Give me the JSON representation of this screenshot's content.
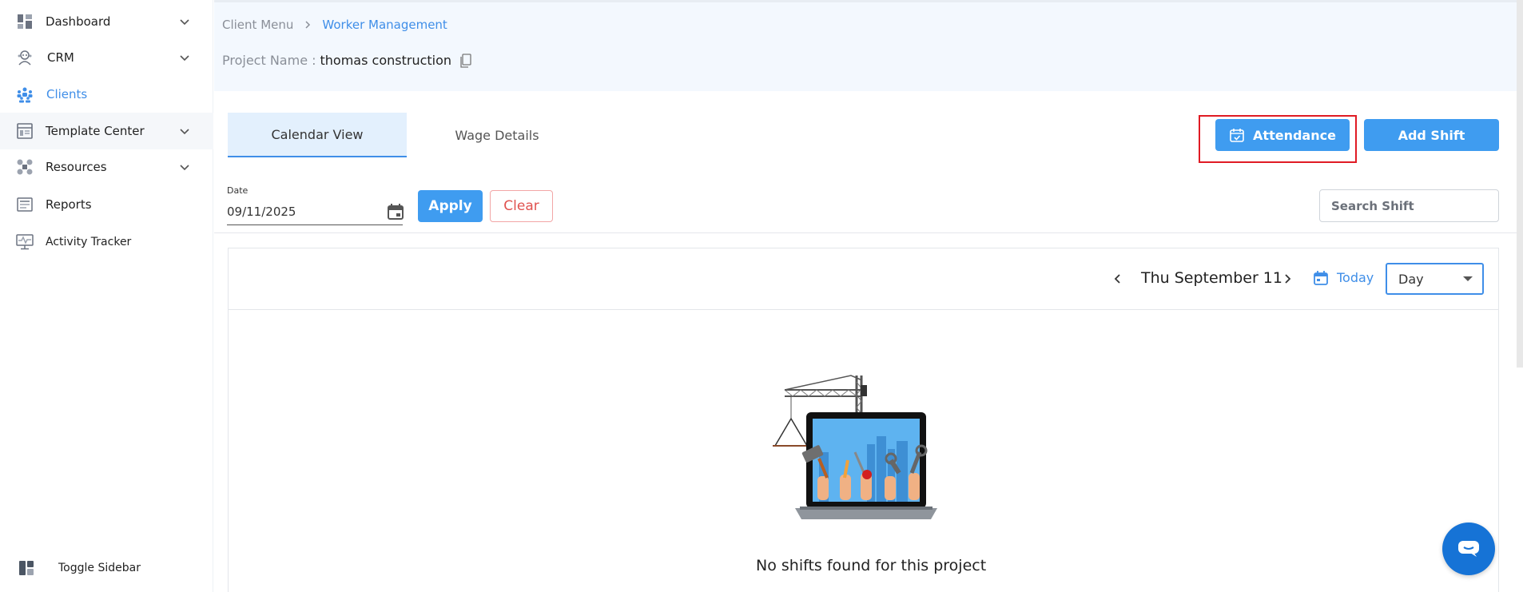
{
  "sidebar": {
    "items": [
      {
        "label": "Dashboard",
        "icon": "dashboard-icon",
        "has_chevron": true
      },
      {
        "label": "CRM",
        "icon": "crm-icon",
        "has_chevron": true
      },
      {
        "label": "Clients",
        "icon": "clients-icon",
        "has_chevron": false,
        "active": true
      },
      {
        "label": "Template Center",
        "icon": "template-icon",
        "has_chevron": true
      },
      {
        "label": "Resources",
        "icon": "resources-icon",
        "has_chevron": true
      },
      {
        "label": "Reports",
        "icon": "reports-icon",
        "has_chevron": false
      },
      {
        "label": "Activity Tracker",
        "icon": "activity-icon",
        "has_chevron": false
      }
    ],
    "toggle_label": "Toggle Sidebar"
  },
  "breadcrumb": {
    "root": "Client Menu",
    "current": "Worker Management"
  },
  "project": {
    "label": "Project Name :",
    "name": "thomas construction"
  },
  "tabs": [
    {
      "label": "Calendar View",
      "active": true
    },
    {
      "label": "Wage Details",
      "active": false
    }
  ],
  "actions": {
    "attendance_label": "Attendance",
    "add_shift_label": "Add Shift"
  },
  "filter": {
    "date_label": "Date",
    "date_value": "09/11/2025",
    "apply_label": "Apply",
    "clear_label": "Clear",
    "search_placeholder": "Search Shift"
  },
  "calendar": {
    "current_date": "Thu September 11",
    "today_label": "Today",
    "view_selected": "Day",
    "empty_message": "No shifts found for this project"
  },
  "colors": {
    "accent": "#3f9cf0",
    "link": "#3f8ee8",
    "highlight": "#e01b24",
    "header_bg": "#f3f8fe"
  }
}
